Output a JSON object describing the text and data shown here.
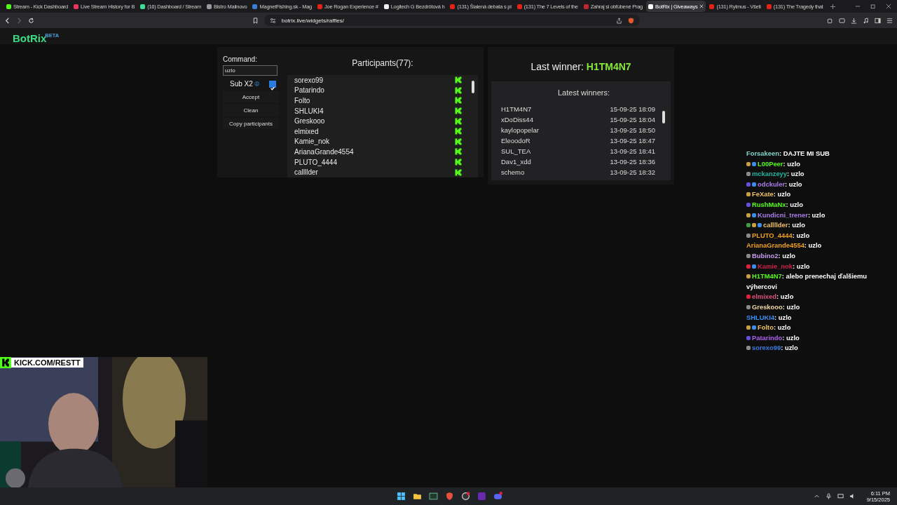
{
  "browser": {
    "tabs": [
      {
        "title": "Stream - Kick Dashboard",
        "color": "#53fc18",
        "selected": false
      },
      {
        "title": "Live Stream History for B",
        "color": "#e8365d",
        "selected": false
      },
      {
        "title": "(16) Dashboard / Stream",
        "color": "#3ddc97",
        "selected": false
      },
      {
        "title": "Bistro Malinovo",
        "color": "#9a9a9a",
        "selected": false
      },
      {
        "title": "MagnetFishing.sk - Mag",
        "color": "#3a7bd5",
        "selected": false
      },
      {
        "title": "Joe Rogan Experience #",
        "color": "#e62117",
        "selected": false
      },
      {
        "title": "Logitech G Bezdrôtová h",
        "color": "#f0f0f0",
        "selected": false
      },
      {
        "title": "(131) Šialená debata s pi",
        "color": "#e62117",
        "selected": false
      },
      {
        "title": "(131) The 7 Levels of the",
        "color": "#e62117",
        "selected": false
      },
      {
        "title": "Zahraj si obľúbené Prag",
        "color": "#c0262d",
        "selected": false
      },
      {
        "title": "BotRix | Giveaways",
        "color": "#ffffff",
        "selected": true
      },
      {
        "title": "(131) Rytmus - Všeti",
        "color": "#e62117",
        "selected": false
      },
      {
        "title": "(131) The Tragedy that",
        "color": "#e62117",
        "selected": false
      }
    ],
    "address": "botrix.live/widgets/raffles/"
  },
  "logo": {
    "name": "BotRix",
    "badge": "BETA"
  },
  "raffle": {
    "command_label": "Command:",
    "command_value": "uzlo",
    "sub_option": {
      "label": "Sub X2",
      "checked": true
    },
    "buttons": [
      "Accept",
      "Clean",
      "Copy participants"
    ],
    "participants_title": "Participants(77):",
    "participants": [
      "sorexo99",
      "Patarindo",
      "Folto",
      "SHLUKI4",
      "Greskooo",
      "elmixed",
      "Kamie_nok",
      "ArianaGrande4554",
      "PLUTO_4444",
      "callllder"
    ]
  },
  "winners": {
    "last_winner_label": "Last winner:",
    "last_winner": "H1TM4N7",
    "latest_title": "Latest winners:",
    "latest": [
      {
        "name": "H1TM4N7",
        "time": "15-09-25 18:09"
      },
      {
        "name": "xDoDiss44",
        "time": "15-09-25 18:04"
      },
      {
        "name": "kaylopopelar",
        "time": "13-09-25 18:50"
      },
      {
        "name": "EleoodoR",
        "time": "13-09-25 18:47"
      },
      {
        "name": "SUL_TEA",
        "time": "13-09-25 18:41"
      },
      {
        "name": "Dav1_xdd",
        "time": "13-09-25 18:36"
      },
      {
        "name": "schemo",
        "time": "13-09-25 18:32"
      }
    ]
  },
  "chat": [
    {
      "user": "Forsakeen",
      "color": "#7fd4c8",
      "message": ": DAJTE MI SUB"
    },
    {
      "user": "L00Peer",
      "color": "#53fc18",
      "message": ": uzlo",
      "badges": [
        {
          "kind": "crown"
        },
        {
          "kind": "gift"
        }
      ]
    },
    {
      "user": "mckanzeyy",
      "color": "#1fb5a0",
      "message": ": uzlo",
      "badges": [
        {
          "kind": "shield"
        }
      ]
    },
    {
      "user": "odckuler",
      "color": "#a97be8",
      "message": ": uzlo",
      "badges": [
        {
          "kind": "gem"
        },
        {
          "kind": "gift"
        }
      ]
    },
    {
      "user": "FeXate",
      "color": "#f0c060",
      "message": ": uzlo",
      "badges": [
        {
          "kind": "crown"
        }
      ]
    },
    {
      "user": "RushMaNx",
      "color": "#53fc18",
      "message": ": uzlo",
      "badges": [
        {
          "kind": "gem"
        }
      ]
    },
    {
      "user": "Kundicni_trener",
      "color": "#a97be8",
      "message": ": uzlo",
      "badges": [
        {
          "kind": "crown"
        },
        {
          "kind": "gift"
        }
      ]
    },
    {
      "user": "callllder",
      "color": "#f0c060",
      "message": ": uzlo",
      "badges": [
        {
          "kind": "rank"
        },
        {
          "kind": "crown"
        },
        {
          "kind": "gift"
        }
      ]
    },
    {
      "user": "PLUTO_4444",
      "color": "#f0a020",
      "message": ": uzlo",
      "badges": [
        {
          "kind": "shield"
        }
      ]
    },
    {
      "user": "ArianaGrande4554",
      "color": "#f0a020",
      "message": ": uzlo"
    },
    {
      "user": "Bubino2",
      "color": "#c79af0",
      "message": ": uzlo",
      "badges": [
        {
          "kind": "shield"
        }
      ]
    },
    {
      "user": "Kamie_nok",
      "color": "#d0204a",
      "message": ": uzlo",
      "badges": [
        {
          "kind": "heart"
        },
        {
          "kind": "gift"
        }
      ]
    },
    {
      "user": "H1TM4N7",
      "color": "#53fc18",
      "message": ": alebo prenechaj ďalšiemu výhercovi",
      "badges": [
        {
          "kind": "crown"
        }
      ]
    },
    {
      "user": "elmixed",
      "color": "#e0507a",
      "message": ": uzlo",
      "badges": [
        {
          "kind": "heart"
        }
      ]
    },
    {
      "user": "Greskooo",
      "color": "#f0d8a0",
      "message": ": uzlo",
      "badges": [
        {
          "kind": "shield"
        }
      ]
    },
    {
      "user": "SHLUKI4",
      "color": "#3a8ef0",
      "message": ": uzlo"
    },
    {
      "user": "Folto",
      "color": "#f0c060",
      "message": ": uzlo",
      "badges": [
        {
          "kind": "crown"
        },
        {
          "kind": "gift"
        }
      ]
    },
    {
      "user": "Patarindo",
      "color": "#b060f0",
      "message": ": uzlo",
      "badges": [
        {
          "kind": "gem"
        }
      ]
    },
    {
      "user": "sorexo99",
      "color": "#3a7be0",
      "message": ": uzlo",
      "badges": [
        {
          "kind": "shield"
        }
      ]
    }
  ],
  "webcam": {
    "channel": "KICK.COM/RESTT"
  },
  "taskbar": {
    "time": "6:11 PM",
    "date": "9/15/2025"
  }
}
